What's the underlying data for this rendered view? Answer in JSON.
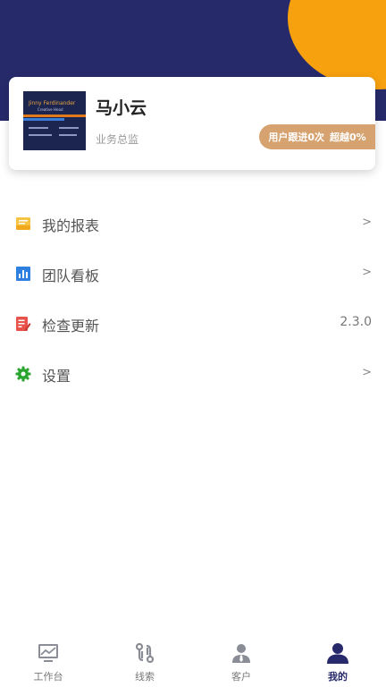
{
  "profile": {
    "name": "马小云",
    "role": "业务总监",
    "stats": {
      "follow_up": "用户跟进0次",
      "exceed": "超越0%"
    },
    "card_image": {
      "name": "Jinny Ferdinander",
      "title": "Creative Head"
    }
  },
  "menu": {
    "items": [
      {
        "label": "我的报表",
        "arrow": ">"
      },
      {
        "label": "团队看板",
        "arrow": ">"
      },
      {
        "label": "检查更新",
        "value": "2.3.0"
      },
      {
        "label": "设置",
        "arrow": ">"
      }
    ]
  },
  "tabbar": {
    "tabs": [
      {
        "label": "工作台"
      },
      {
        "label": "线索"
      },
      {
        "label": "客户"
      },
      {
        "label": "我的"
      }
    ]
  },
  "colors": {
    "header": "#262a6a",
    "accent_circle": "#f7a10f",
    "badge": "#d6a26f"
  }
}
